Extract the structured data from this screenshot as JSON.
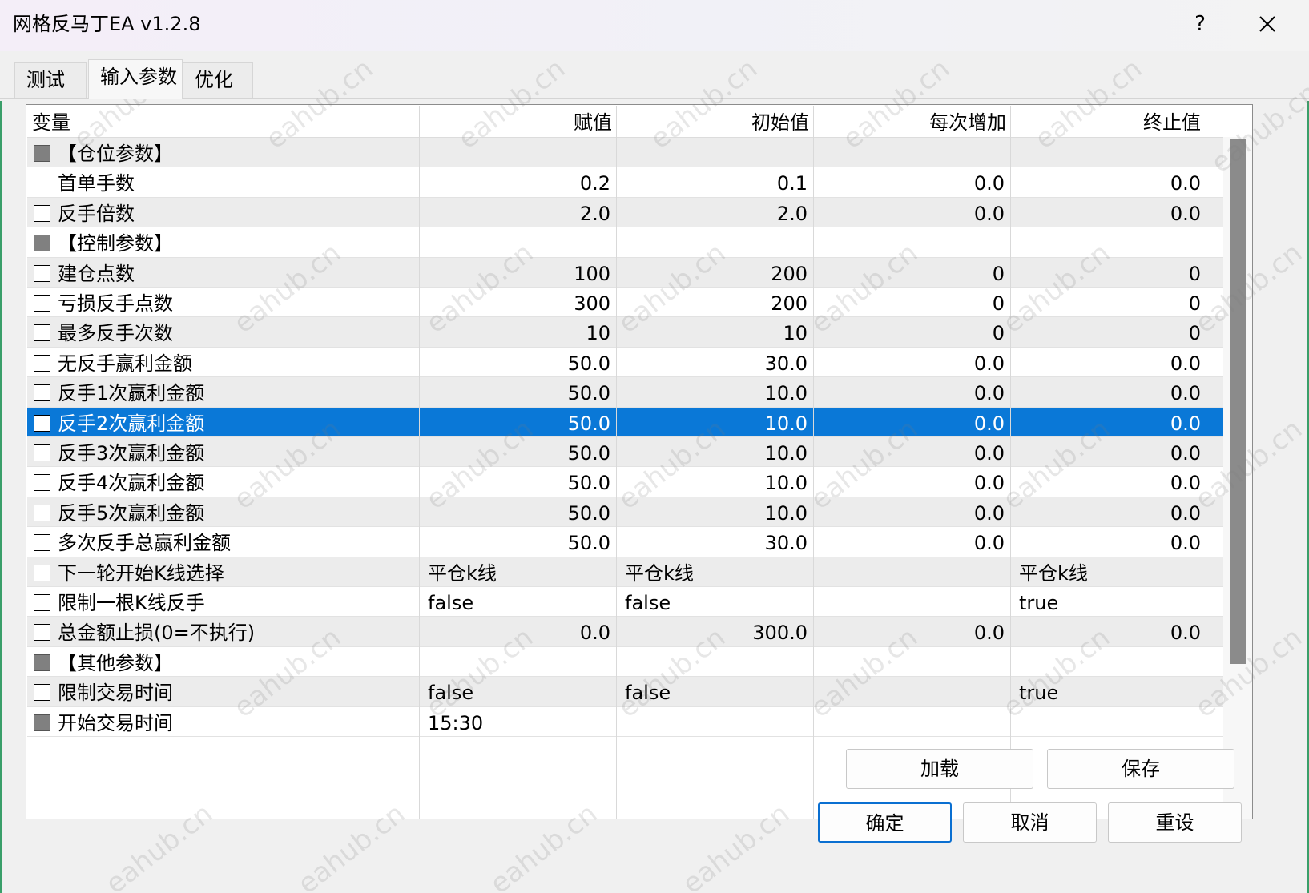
{
  "window": {
    "title": "网格反马丁EA v1.2.8",
    "help_label": "?"
  },
  "tabs": [
    {
      "label": "测试"
    },
    {
      "label": "输入参数"
    },
    {
      "label": "优化"
    }
  ],
  "active_tab": "输入参数",
  "grid": {
    "columns": [
      "变量",
      "赋值",
      "初始值",
      "每次增加",
      "终止值"
    ],
    "selected_row": "反手2次赢利金额",
    "rows": [
      {
        "name": "【仓位参数】",
        "group": true,
        "v1": "",
        "v2": "",
        "v3": "",
        "v4": ""
      },
      {
        "name": "首单手数",
        "v1": "0.2",
        "v2": "0.1",
        "v3": "0.0",
        "v4": "0.0"
      },
      {
        "name": "反手倍数",
        "v1": "2.0",
        "v2": "2.0",
        "v3": "0.0",
        "v4": "0.0"
      },
      {
        "name": "【控制参数】",
        "group": true,
        "v1": "",
        "v2": "",
        "v3": "",
        "v4": ""
      },
      {
        "name": "建仓点数",
        "v1": "100",
        "v2": "200",
        "v3": "0",
        "v4": "0"
      },
      {
        "name": "亏损反手点数",
        "v1": "300",
        "v2": "200",
        "v3": "0",
        "v4": "0"
      },
      {
        "name": "最多反手次数",
        "v1": "10",
        "v2": "10",
        "v3": "0",
        "v4": "0"
      },
      {
        "name": "无反手赢利金额",
        "v1": "50.0",
        "v2": "30.0",
        "v3": "0.0",
        "v4": "0.0"
      },
      {
        "name": "反手1次赢利金额",
        "v1": "50.0",
        "v2": "10.0",
        "v3": "0.0",
        "v4": "0.0"
      },
      {
        "name": "反手2次赢利金额",
        "v1": "50.0",
        "v2": "10.0",
        "v3": "0.0",
        "v4": "0.0"
      },
      {
        "name": "反手3次赢利金额",
        "v1": "50.0",
        "v2": "10.0",
        "v3": "0.0",
        "v4": "0.0"
      },
      {
        "name": "反手4次赢利金额",
        "v1": "50.0",
        "v2": "10.0",
        "v3": "0.0",
        "v4": "0.0"
      },
      {
        "name": "反手5次赢利金额",
        "v1": "50.0",
        "v2": "10.0",
        "v3": "0.0",
        "v4": "0.0"
      },
      {
        "name": "多次反手总赢利金额",
        "v1": "50.0",
        "v2": "30.0",
        "v3": "0.0",
        "v4": "0.0"
      },
      {
        "name": "下一轮开始K线选择",
        "text": true,
        "v1": "平仓k线",
        "v2": "平仓k线",
        "v3": "",
        "v4": "平仓k线"
      },
      {
        "name": "限制一根K线反手",
        "text": true,
        "v1": "false",
        "v2": "false",
        "v3": "",
        "v4": "true"
      },
      {
        "name": "总金额止损(0=不执行)",
        "v1": "0.0",
        "v2": "300.0",
        "v3": "0.0",
        "v4": "0.0"
      },
      {
        "name": "【其他参数】",
        "group": true,
        "v1": "",
        "v2": "",
        "v3": "",
        "v4": ""
      },
      {
        "name": "限制交易时间",
        "text": true,
        "v1": "false",
        "v2": "false",
        "v3": "",
        "v4": "true"
      },
      {
        "name": "开始交易时间",
        "text": true,
        "greychk": true,
        "v1": "15:30",
        "v2": "",
        "v3": "",
        "v4": ""
      }
    ]
  },
  "buttons": {
    "load": "加载",
    "save": "保存",
    "ok": "确定",
    "cancel": "取消",
    "reset": "重设"
  },
  "colors": {
    "selection": "#0a78d7",
    "row_alt": "#ececec",
    "default_button_border": "#0a6fd1"
  },
  "watermark": "eahub.cn"
}
